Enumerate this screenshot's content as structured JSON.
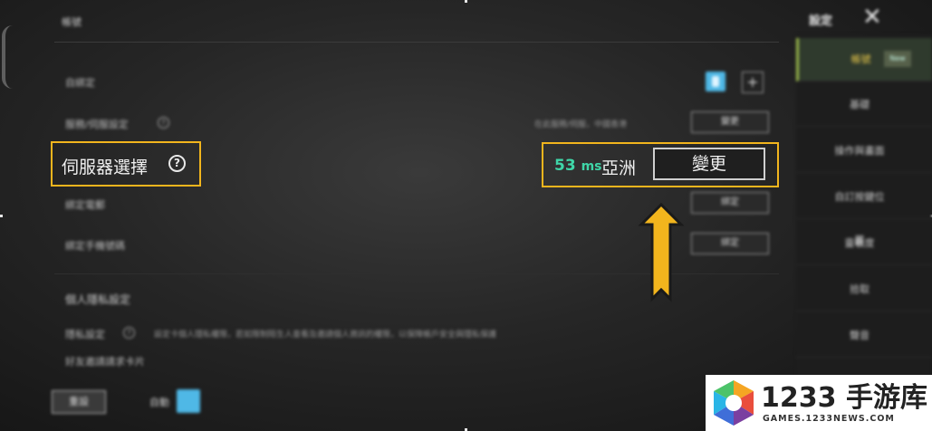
{
  "header": {
    "title": "帳號",
    "settings_label": "設定",
    "close_icon": "close-icon"
  },
  "rows": [
    {
      "label": "自綁定"
    },
    {
      "label": "服務/伺服設定",
      "right_text": "在此服務/伺服，中國香港",
      "button": "變更"
    },
    {
      "label": "綁定電郵",
      "button": "綁定"
    },
    {
      "label": "綁定手機號碼",
      "button": "綁定"
    }
  ],
  "server": {
    "label": "伺服器選擇",
    "ping_value": "53",
    "ping_unit": "ms",
    "region": "亞洲",
    "change_button": "變更"
  },
  "section": {
    "title": "個人隱私設定",
    "subtitle": "隱私設定",
    "description": "設定卡個人隱私權限，若如限制陌生人查看及邀請個人資訊的權限，以保障帳戶安全與隱私保護",
    "extra": "好友邀請請求卡片"
  },
  "sidebar": {
    "items": [
      {
        "label": "帳號",
        "badge": "New"
      },
      {
        "label": "基礎"
      },
      {
        "label": "操作與畫面"
      },
      {
        "label": "自訂按鍵位置"
      },
      {
        "label": "靈敏度"
      },
      {
        "label": "拾取"
      },
      {
        "label": "聲音"
      }
    ]
  },
  "bottom": {
    "button": "重設",
    "label": "自動"
  },
  "watermark": {
    "title": "1233 手游库",
    "url": "GAMES.1233NEWS.COM"
  },
  "colors": {
    "highlight": "#f2b51d",
    "ping": "#3fd6a8",
    "arrow": "#f2b51d"
  }
}
